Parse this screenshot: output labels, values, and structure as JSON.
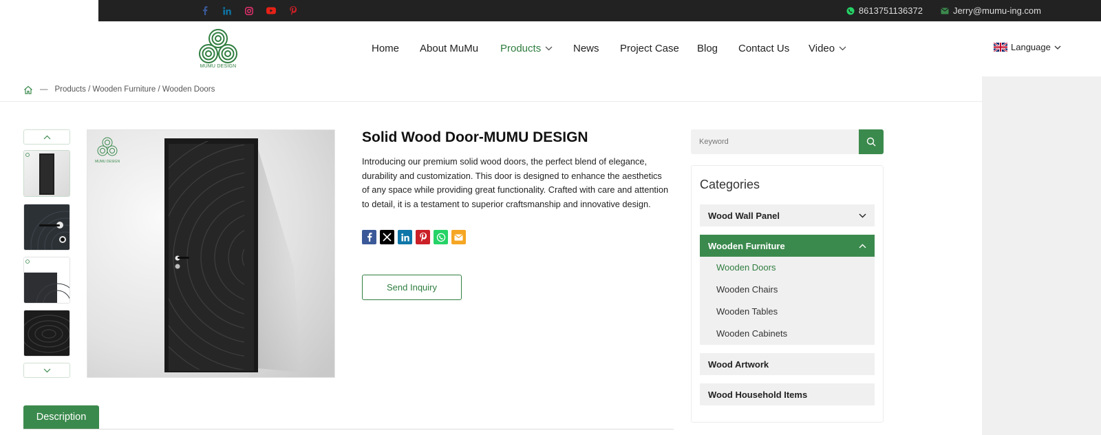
{
  "colors": {
    "accent": "#3b8a4d",
    "topbar": "#222222",
    "facebook": "#3b5998",
    "linkedin": "#0e76a8",
    "instagram": "#e1306c",
    "youtube": "#e62117",
    "pinterest": "#cb2027",
    "whatsapp": "#25d366",
    "email": "#f5a623",
    "twitter": "#000000"
  },
  "topbar": {
    "social_icons": [
      "facebook-icon",
      "linkedin-icon",
      "instagram-icon",
      "youtube-icon",
      "pinterest-icon"
    ],
    "phone": "8613751136372",
    "email": "Jerry@mumu-ing.com"
  },
  "header": {
    "logo_text": "MUMU DESIGN",
    "nav": [
      {
        "label": "Home"
      },
      {
        "label": "About MuMu"
      },
      {
        "label": "Products",
        "dropdown": true,
        "active": true
      },
      {
        "label": "News"
      },
      {
        "label": "Project Case"
      },
      {
        "label": "Blog"
      },
      {
        "label": "Contact Us"
      },
      {
        "label": "Video",
        "dropdown": true
      }
    ],
    "language": "Language"
  },
  "breadcrumb": {
    "separator": "—",
    "path": "Products / Wooden Furniture / Wooden Doors"
  },
  "product": {
    "title": "Solid Wood Door-MUMU DESIGN",
    "description": "Introducing our premium solid wood doors, the perfect blend of elegance, durability and customization. This door is designed to enhance the aesthetics of any space while providing great functionality. Crafted with care and attention to detail, it is a testament to superior craftsmanship and innovative design.",
    "image_logo_text": "MUMU DESIGN",
    "share_icons": [
      "facebook-icon",
      "x-icon",
      "linkedin-icon",
      "pinterest-icon",
      "whatsapp-icon",
      "email-icon"
    ],
    "inquiry_label": "Send Inquiry"
  },
  "tabs": {
    "description": "Description"
  },
  "sidebar": {
    "search_placeholder": "Keyword",
    "categories_title": "Categories",
    "categories": [
      {
        "label": "Wood Wall Panel",
        "open": false
      },
      {
        "label": "Wooden Furniture",
        "open": true,
        "children": [
          "Wooden Doors",
          "Wooden Chairs",
          "Wooden Tables",
          "Wooden Cabinets"
        ],
        "active_child": "Wooden Doors"
      },
      {
        "label": "Wood Artwork",
        "open": false
      },
      {
        "label": "Wood Household Items",
        "open": false
      }
    ]
  }
}
